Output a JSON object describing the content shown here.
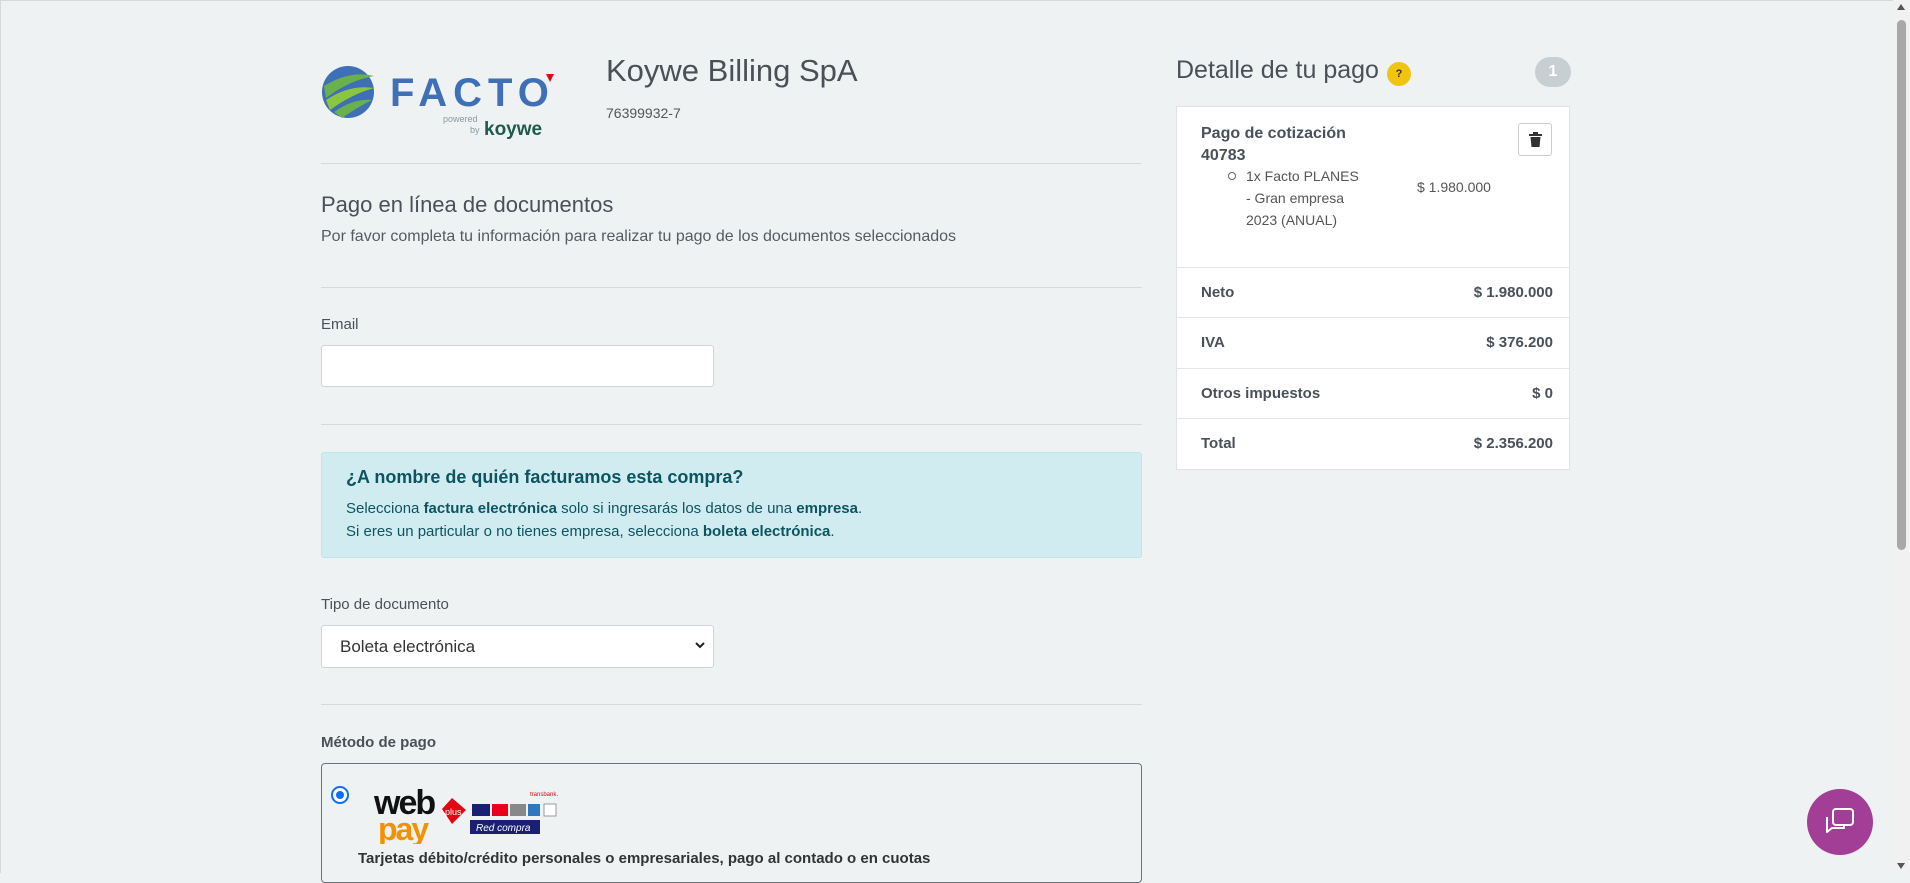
{
  "header": {
    "logo_text": "FACTO",
    "logo_powered": "powered",
    "logo_by": "by",
    "logo_brand": "koywe",
    "company_name": "Koywe Billing SpA",
    "rut": "76399932-7"
  },
  "intro": {
    "title": "Pago en línea de documentos",
    "subtitle": "Por favor completa tu información para realizar tu pago de los documentos seleccionados"
  },
  "email": {
    "label": "Email",
    "value": "",
    "placeholder": ""
  },
  "billing_alert": {
    "title": "¿A nombre de quién facturamos esta compra?",
    "line1_a": "Selecciona ",
    "line1_b": "factura electrónica",
    "line1_c": " solo si ingresarás los datos de una ",
    "line1_d": "empresa",
    "line1_e": ".",
    "line2_a": "Si eres un particular o no tienes empresa, selecciona ",
    "line2_b": "boleta electrónica",
    "line2_c": "."
  },
  "document_type": {
    "label": "Tipo de documento",
    "selected": "Boleta electrónica"
  },
  "payment": {
    "label": "Método de pago",
    "webpay_web": "web",
    "webpay_pay": "pay",
    "webpay_plus": "plus",
    "webpay_transbank": "transbank.",
    "webpay_redcompra": "Red compra",
    "description": "Tarjetas débito/crédito personales o empresariales, pago al contado o en cuotas"
  },
  "detail": {
    "title": "Detalle de tu pago",
    "help_label": "?",
    "count": "1",
    "item_title": "Pago de cotización 40783",
    "item_line": "1x Facto PLANES - Gran empresa 2023 (ANUAL)",
    "item_amount": "$ 1.980.000",
    "rows": [
      {
        "key": "Neto",
        "value": "$ 1.980.000"
      },
      {
        "key": "IVA",
        "value": "$ 376.200"
      },
      {
        "key": "Otros impuestos",
        "value": "$ 0"
      },
      {
        "key": "Total",
        "value": "$ 2.356.200"
      }
    ]
  },
  "colors": {
    "background": "#eef2f3",
    "alert_bg": "#d1ecf1",
    "alert_text": "#0c5460",
    "help_icon": "#f1c40f",
    "chat_button": "#a33e96",
    "radio": "#0d6efd",
    "logo_blue": "#3f6fb6",
    "logo_green": "#6ab04c",
    "webpay_red": "#e30613",
    "webpay_orange": "#f39200"
  }
}
